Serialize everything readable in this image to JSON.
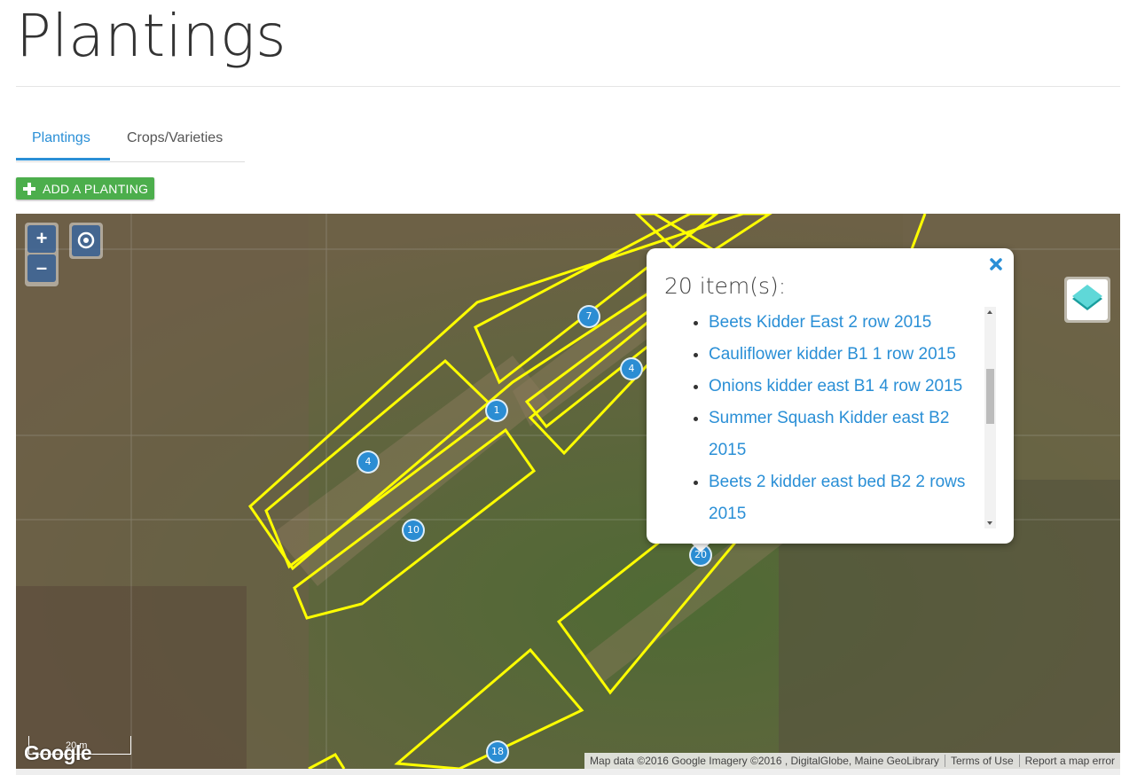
{
  "page": {
    "title": "Plantings"
  },
  "tabs": [
    {
      "label": "Plantings",
      "active": true
    },
    {
      "label": "Crops/Varieties",
      "active": false
    }
  ],
  "toolbar": {
    "add_label": "ADD A PLANTING",
    "add_icon": "plus-icon",
    "add_color": "#4cae4c"
  },
  "map": {
    "controls": {
      "zoom_in": "+",
      "zoom_out": "–",
      "geolocate_icon": "target-icon",
      "layers_icon": "layers-icon"
    },
    "markers": [
      "7",
      "4",
      "1",
      "4",
      "10",
      "20",
      "18"
    ],
    "popup": {
      "title": "20 item(s):",
      "close_icon": "close-icon",
      "items": [
        "Beets Kidder East 2 row 2015",
        "Cauliflower kidder B1 1 row 2015",
        "Onions kidder east B1 4 row 2015",
        "Summer Squash Kidder east B2 2015",
        "Beets 2 kidder east bed B2 2 rows 2015"
      ]
    },
    "scale_label": "20 m",
    "logo": "Google",
    "attribution": {
      "data": "Map data ©2016 Google Imagery ©2016 , DigitalGlobe, Maine GeoLibrary",
      "terms": "Terms of Use",
      "report": "Report a map error"
    },
    "colors": {
      "outline": "#ffff00",
      "marker": "#2b8dd3",
      "link": "#2a8fd6"
    }
  }
}
